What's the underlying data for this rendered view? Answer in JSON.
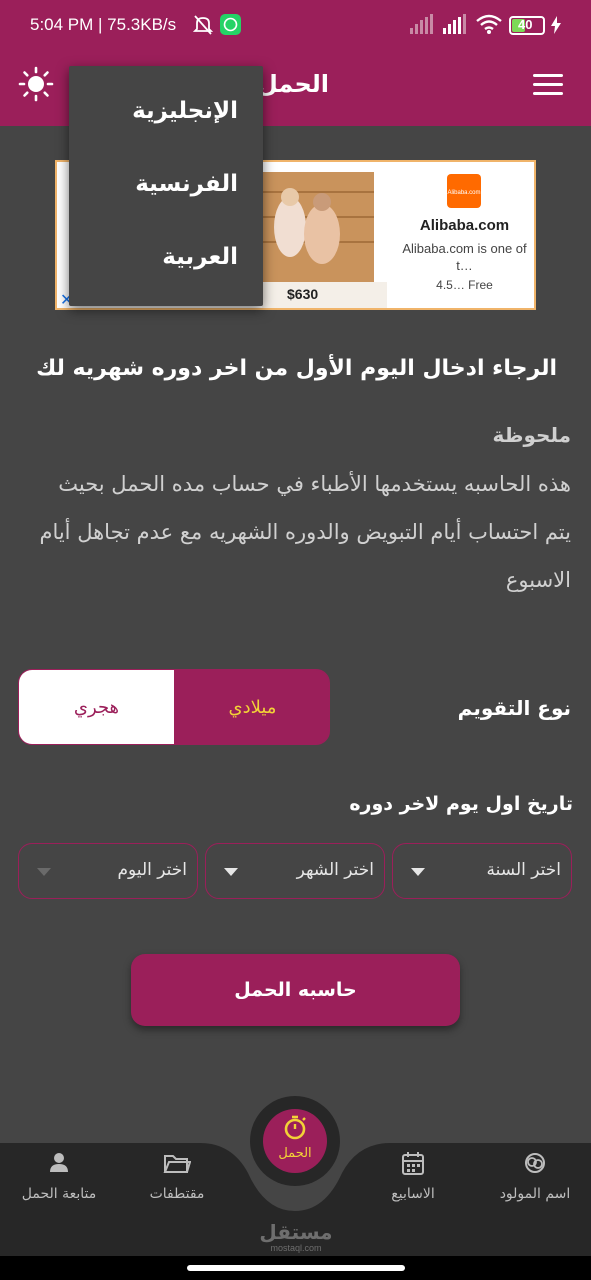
{
  "status_bar": {
    "time": "5:04 PM | 75.3KB/s",
    "battery": "40"
  },
  "app_bar": {
    "title": "الحمل"
  },
  "language_menu": {
    "items": [
      "الإنجليزية",
      "الفرنسية",
      "العربية"
    ]
  },
  "ad": {
    "price": "$630",
    "logo_text": "Alibaba.com",
    "name": "Alibaba.com",
    "description": "Alibaba.com is one of t…",
    "rating": "4.5… Free"
  },
  "main": {
    "prompt": "الرجاء ادخال اليوم الأول من اخر دوره شهريه لك",
    "note_title": "ملحوظة",
    "note_body": "هذه الحاسبه يستخدمها الأطباء في حساب مده الحمل بحيث يتم احتساب أيام التبويض والدوره الشهريه مع عدم تجاهل أيام الاسبوع",
    "calendar_label": "نوع التقويم",
    "calendar_options": {
      "gregorian": "ميلادي",
      "hijri": "هجري",
      "selected": "ميلادي"
    },
    "date_label": "تاريخ اول يوم لاخر دوره",
    "selects": {
      "year": "اختر السنة",
      "month": "اختر الشهر",
      "day": "اختر اليوم"
    },
    "calculate_button": "حاسبه الحمل"
  },
  "bottom_nav": {
    "items": [
      {
        "label": "اسم المولود",
        "icon": "baby-name-icon"
      },
      {
        "label": "الاسابيع",
        "icon": "calendar-icon"
      },
      {
        "label": "الحمل",
        "icon": "timer-icon"
      },
      {
        "label": "مقتطفات",
        "icon": "folder-icon"
      },
      {
        "label": "متابعة الحمل",
        "icon": "person-icon"
      }
    ]
  },
  "watermark": {
    "text": "مستقل",
    "sub": "mostaql.com"
  },
  "colors": {
    "primary": "#9b1f5a",
    "background": "#454545",
    "accent_yellow": "#f2d237"
  }
}
